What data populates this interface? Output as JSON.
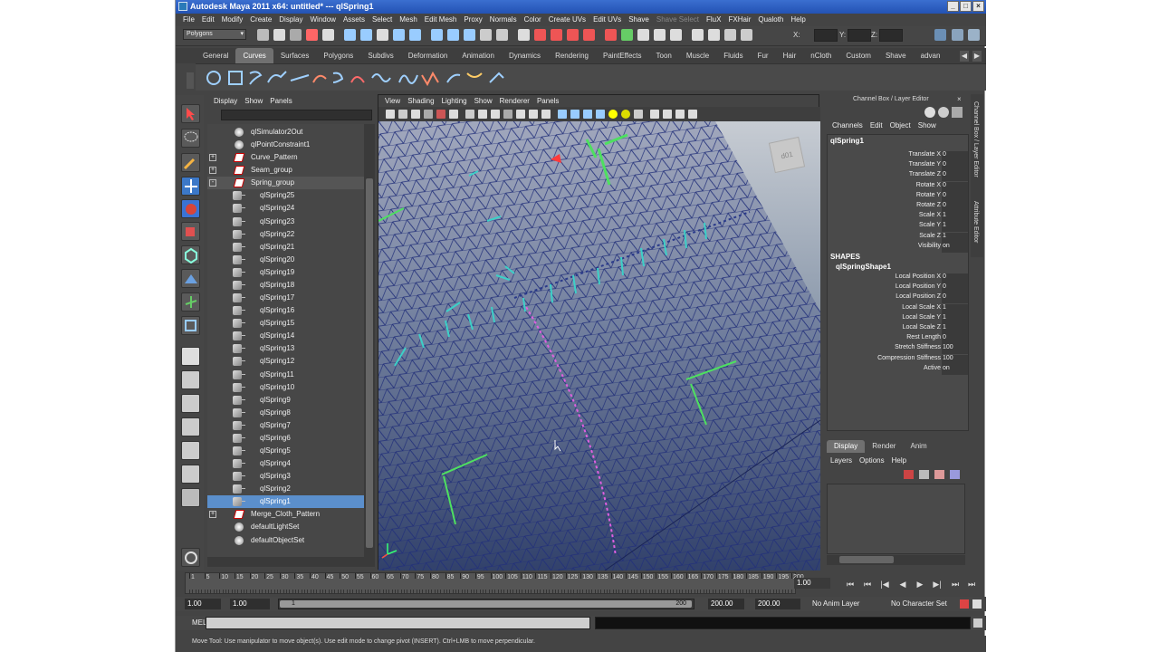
{
  "window": {
    "title": "Autodesk Maya 2011 x64: untitled*   ---   qlSpring1",
    "min": "_",
    "max": "□",
    "close": "×"
  },
  "menus": [
    "File",
    "Edit",
    "Modify",
    "Create",
    "Display",
    "Window",
    "Assets",
    "Select",
    "Mesh",
    "Edit Mesh",
    "Proxy",
    "Normals",
    "Color",
    "Create UVs",
    "Edit UVs",
    "Shave",
    "Shave Select",
    "FluX",
    "FXHair",
    "Qualoth",
    "Help"
  ],
  "status": {
    "mode": "Polygons",
    "x_label": "X:",
    "y_label": "Y:",
    "z_label": "Z:"
  },
  "shelf_tabs": [
    "General",
    "Curves",
    "Surfaces",
    "Polygons",
    "Subdivs",
    "Deformation",
    "Animation",
    "Dynamics",
    "Rendering",
    "PaintEffects",
    "Toon",
    "Muscle",
    "Fluids",
    "Fur",
    "Hair",
    "nCloth",
    "Custom",
    "Shave",
    "advan"
  ],
  "outliner": {
    "menu": [
      "Display",
      "Show",
      "Panels"
    ],
    "items": [
      {
        "label": "qlSimulator2Out",
        "indent": 0,
        "icon": "set"
      },
      {
        "label": "qlPointConstraint1",
        "indent": 0,
        "icon": "set"
      },
      {
        "label": "Curve_Pattern",
        "indent": 0,
        "icon": "curve",
        "exp": "+"
      },
      {
        "label": "Seam_group",
        "indent": 0,
        "icon": "curve",
        "exp": "+"
      },
      {
        "label": "Spring_group",
        "indent": 0,
        "icon": "curve",
        "exp": "-",
        "grp": true
      },
      {
        "label": "qlSpring25",
        "indent": 1,
        "icon": "mesh"
      },
      {
        "label": "qlSpring24",
        "indent": 1,
        "icon": "mesh"
      },
      {
        "label": "qlSpring23",
        "indent": 1,
        "icon": "mesh"
      },
      {
        "label": "qlSpring22",
        "indent": 1,
        "icon": "mesh"
      },
      {
        "label": "qlSpring21",
        "indent": 1,
        "icon": "mesh"
      },
      {
        "label": "qlSpring20",
        "indent": 1,
        "icon": "mesh"
      },
      {
        "label": "qlSpring19",
        "indent": 1,
        "icon": "mesh"
      },
      {
        "label": "qlSpring18",
        "indent": 1,
        "icon": "mesh"
      },
      {
        "label": "qlSpring17",
        "indent": 1,
        "icon": "mesh"
      },
      {
        "label": "qlSpring16",
        "indent": 1,
        "icon": "mesh"
      },
      {
        "label": "qlSpring15",
        "indent": 1,
        "icon": "mesh"
      },
      {
        "label": "qlSpring14",
        "indent": 1,
        "icon": "mesh"
      },
      {
        "label": "qlSpring13",
        "indent": 1,
        "icon": "mesh"
      },
      {
        "label": "qlSpring12",
        "indent": 1,
        "icon": "mesh"
      },
      {
        "label": "qlSpring11",
        "indent": 1,
        "icon": "mesh"
      },
      {
        "label": "qlSpring10",
        "indent": 1,
        "icon": "mesh"
      },
      {
        "label": "qlSpring9",
        "indent": 1,
        "icon": "mesh"
      },
      {
        "label": "qlSpring8",
        "indent": 1,
        "icon": "mesh"
      },
      {
        "label": "qlSpring7",
        "indent": 1,
        "icon": "mesh"
      },
      {
        "label": "qlSpring6",
        "indent": 1,
        "icon": "mesh"
      },
      {
        "label": "qlSpring5",
        "indent": 1,
        "icon": "mesh"
      },
      {
        "label": "qlSpring4",
        "indent": 1,
        "icon": "mesh"
      },
      {
        "label": "qlSpring3",
        "indent": 1,
        "icon": "mesh"
      },
      {
        "label": "qlSpring2",
        "indent": 1,
        "icon": "mesh"
      },
      {
        "label": "qlSpring1",
        "indent": 1,
        "icon": "mesh",
        "sel": true
      },
      {
        "label": "Merge_Cloth_Pattern",
        "indent": 0,
        "icon": "curve",
        "exp": "+"
      },
      {
        "label": "defaultLightSet",
        "indent": 0,
        "icon": "set"
      },
      {
        "label": "defaultObjectSet",
        "indent": 0,
        "icon": "set"
      }
    ]
  },
  "viewport": {
    "menu": [
      "View",
      "Shading",
      "Lighting",
      "Show",
      "Renderer",
      "Panels"
    ],
    "cube_label": "d01"
  },
  "channel_box": {
    "header": "Channel Box / Layer Editor",
    "menu": [
      "Channels",
      "Edit",
      "Object",
      "Show"
    ],
    "object": "qlSpring1",
    "attrs": [
      {
        "name": "Translate X",
        "value": "0"
      },
      {
        "name": "Translate Y",
        "value": "0"
      },
      {
        "name": "Translate Z",
        "value": "0"
      },
      {
        "name": "Rotate X",
        "value": "0"
      },
      {
        "name": "Rotate Y",
        "value": "0"
      },
      {
        "name": "Rotate Z",
        "value": "0"
      },
      {
        "name": "Scale X",
        "value": "1"
      },
      {
        "name": "Scale Y",
        "value": "1"
      },
      {
        "name": "Scale Z",
        "value": "1"
      },
      {
        "name": "Visibility",
        "value": "on"
      }
    ],
    "shapes_label": "SHAPES",
    "shape_name": "qlSpringShape1",
    "shape_attrs": [
      {
        "name": "Local Position X",
        "value": "0"
      },
      {
        "name": "Local Position Y",
        "value": "0"
      },
      {
        "name": "Local Position Z",
        "value": "0"
      },
      {
        "name": "Local Scale X",
        "value": "1"
      },
      {
        "name": "Local Scale Y",
        "value": "1"
      },
      {
        "name": "Local Scale Z",
        "value": "1"
      },
      {
        "name": "Rest Length",
        "value": "0"
      },
      {
        "name": "Stretch Stiffness",
        "value": "100"
      },
      {
        "name": "Compression Stiffness",
        "value": "100"
      },
      {
        "name": "Active",
        "value": "on"
      }
    ]
  },
  "side_tabs": [
    "Channel Box / Layer Editor",
    "Attribute Editor"
  ],
  "layer_editor": {
    "tabs": [
      "Display",
      "Render",
      "Anim"
    ],
    "menu": [
      "Layers",
      "Options",
      "Help"
    ]
  },
  "timeline": {
    "ticks": [
      "1",
      "5",
      "10",
      "15",
      "20",
      "25",
      "30",
      "35",
      "40",
      "45",
      "50",
      "55",
      "60",
      "65",
      "70",
      "75",
      "80",
      "85",
      "90",
      "95",
      "100",
      "105",
      "110",
      "115",
      "120",
      "125",
      "130",
      "135",
      "140",
      "145",
      "150",
      "155",
      "160",
      "165",
      "170",
      "175",
      "180",
      "185",
      "190",
      "195",
      "200"
    ],
    "current_frame": "1.00"
  },
  "playback": [
    "⏮",
    "⏮",
    "|◀",
    "◀",
    "▶",
    "▶|",
    "⏭",
    "⏭"
  ],
  "range": {
    "start": "1.00",
    "playback_start": "1.00",
    "slider_start": "1",
    "slider_end": "200",
    "playback_end": "200.00",
    "end": "200.00",
    "anim_layer": "No Anim Layer",
    "character_set": "No Character Set"
  },
  "mel": {
    "label": "MEL"
  },
  "help_line": "Move Tool: Use manipulator to move object(s). Use edit mode to change pivot (INSERT). Ctrl+LMB to move perpendicular."
}
